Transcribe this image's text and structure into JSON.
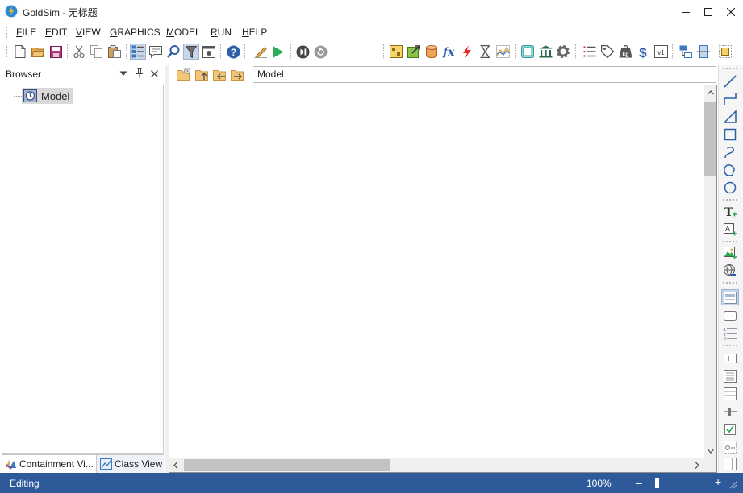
{
  "window": {
    "app_name": "GoldSim",
    "title_suffix": " - 无标题"
  },
  "menu": {
    "items": [
      {
        "mnemonic": "F",
        "rest": "ILE"
      },
      {
        "mnemonic": "E",
        "rest": "DIT"
      },
      {
        "mnemonic": "V",
        "rest": "IEW"
      },
      {
        "mnemonic": "G",
        "rest": "RAPHICS"
      },
      {
        "mnemonic": "M",
        "rest": "ODEL"
      },
      {
        "mnemonic": "R",
        "rest": "UN"
      },
      {
        "mnemonic": "H",
        "rest": "ELP"
      }
    ]
  },
  "browser": {
    "title": "Browser",
    "tree_root": "Model",
    "tabs": [
      "Containment Vi...",
      "Class View"
    ]
  },
  "path": {
    "value": "Model"
  },
  "status": {
    "text": "Editing",
    "zoom": "100%",
    "zoom_level_fraction": 0.15
  },
  "colors": {
    "status_bar": "#2e5a9a",
    "accent": "#3a78c4",
    "run_green": "#2eaa5c",
    "folder": "#e4a94a",
    "selection": "#c9d5e8"
  }
}
